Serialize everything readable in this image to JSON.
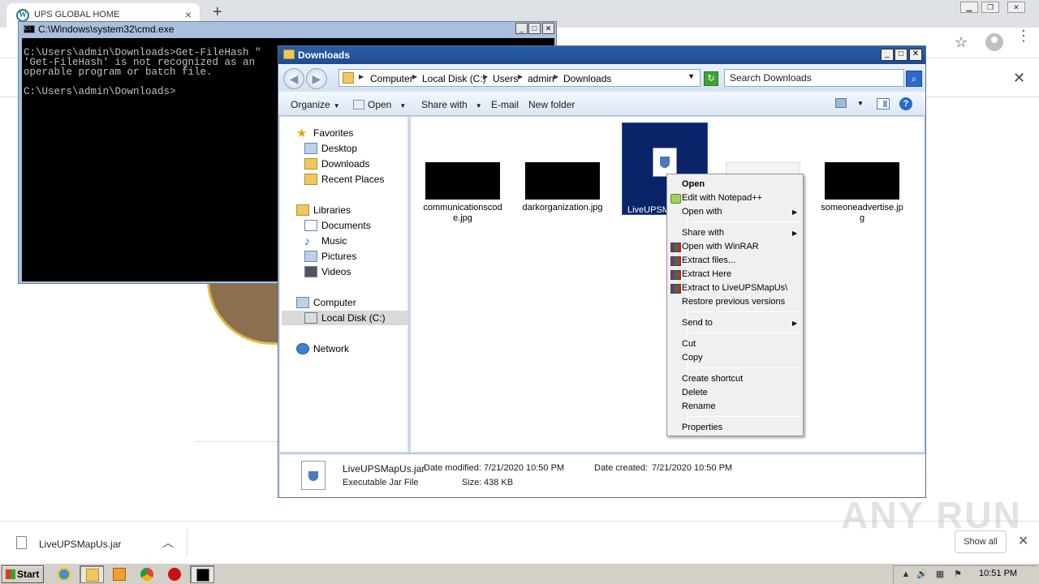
{
  "browser": {
    "tab_title": "UPS GLOBAL HOME",
    "tab_close": "×",
    "new_tab": "+",
    "menu": "⋮",
    "infobar_close": "✕"
  },
  "cmd": {
    "title": "C:\\Windows\\system32\\cmd.exe",
    "console_text": "C:\\Users\\admin\\Downloads>Get-FileHash \"\n'Get-FileHash' is not recognized as an \noperable program or batch file.\n\nC:\\Users\\admin\\Downloads>"
  },
  "explorer": {
    "title": "Downloads",
    "breadcrumbs": [
      "Computer",
      "Local Disk (C:)",
      "Users",
      "admin",
      "Downloads"
    ],
    "search_placeholder": "Search Downloads",
    "toolbar": {
      "organize": "Organize",
      "open": "Open",
      "share_with": "Share with",
      "email": "E-mail",
      "new_folder": "New folder"
    },
    "nav": {
      "favorites": "Favorites",
      "desktop": "Desktop",
      "downloads": "Downloads",
      "recent_places": "Recent Places",
      "libraries": "Libraries",
      "documents": "Documents",
      "music": "Music",
      "pictures": "Pictures",
      "videos": "Videos",
      "computer": "Computer",
      "local_disk": "Local Disk (C:)",
      "network": "Network"
    },
    "files": [
      {
        "name": "communicationscode.jpg"
      },
      {
        "name": "darkorganization.jpg"
      },
      {
        "name": "LiveUPSM"
      },
      {
        "name": ""
      },
      {
        "name": "someoneadvertise.jpg"
      }
    ],
    "details": {
      "filename": "LiveUPSMapUs.jar",
      "type": "Executable Jar File",
      "date_modified_label": "Date modified:",
      "date_modified": "7/21/2020 10:50 PM",
      "date_created_label": "Date created:",
      "date_created": "7/21/2020 10:50 PM",
      "size_label": "Size:",
      "size": "438 KB"
    }
  },
  "context_menu": {
    "open": "Open",
    "edit_npp": "Edit with Notepad++",
    "open_with": "Open with",
    "share_with": "Share with",
    "open_winrar": "Open with WinRAR",
    "extract_files": "Extract files...",
    "extract_here": "Extract Here",
    "extract_to": "Extract to LiveUPSMapUs\\",
    "restore_prev": "Restore previous versions",
    "send_to": "Send to",
    "cut": "Cut",
    "copy": "Copy",
    "create_shortcut": "Create shortcut",
    "delete": "Delete",
    "rename": "Rename",
    "properties": "Properties"
  },
  "downloads_shelf": {
    "file_name": "LiveUPSMapUs.jar",
    "show_all": "Show all",
    "close": "✕"
  },
  "watermark": "ANY RUN",
  "taskbar": {
    "start": "Start",
    "clock": "10:51 PM"
  },
  "colors": {
    "explorer_title": "#1d4b8f",
    "selection": "#0a246a",
    "console_bg": "#000000"
  }
}
